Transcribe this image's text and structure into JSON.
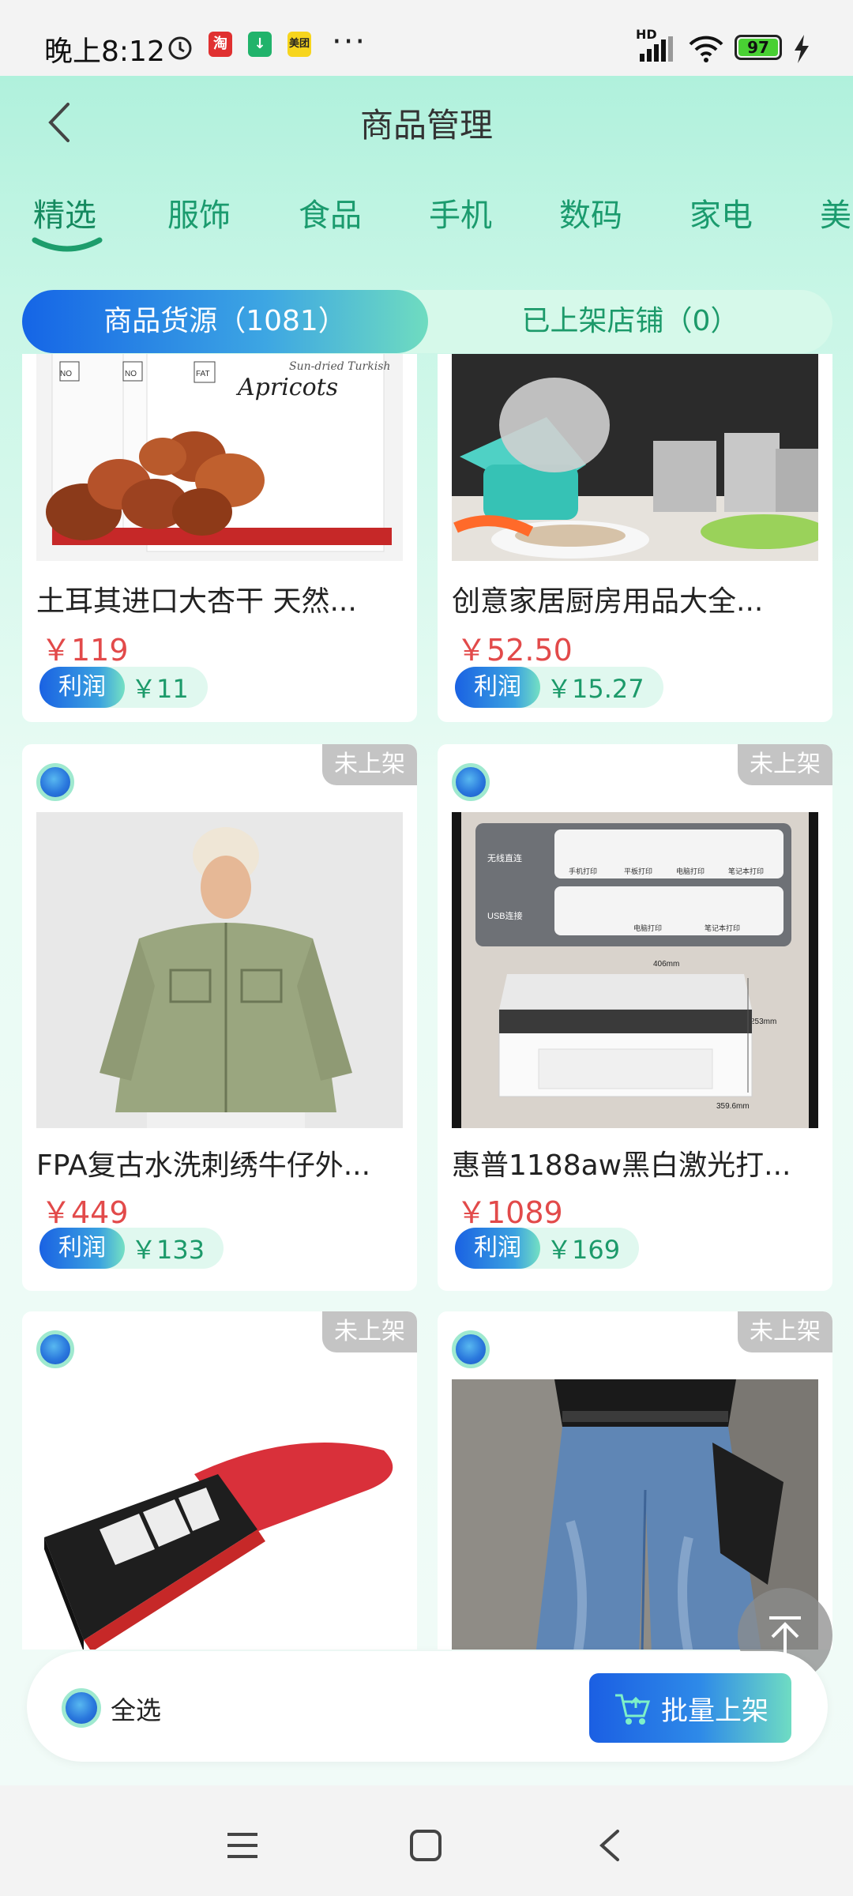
{
  "status_bar": {
    "time": "晚上8:12",
    "apps": [
      {
        "icon": "alarm-icon"
      },
      {
        "icon": "taobao-icon",
        "text": "淘",
        "color": "#e03030"
      },
      {
        "icon": "download-icon",
        "text": "↓",
        "color": "#21b36b"
      },
      {
        "icon": "meituan-icon",
        "text": "美团",
        "color": "#f7d51d"
      }
    ],
    "more": "···",
    "network": "HD",
    "battery": "97"
  },
  "header": {
    "title": "商品管理"
  },
  "categories": [
    {
      "label": "精选",
      "active": true
    },
    {
      "label": "服饰"
    },
    {
      "label": "食品"
    },
    {
      "label": "手机"
    },
    {
      "label": "数码"
    },
    {
      "label": "家电"
    },
    {
      "label": "美"
    }
  ],
  "segments": [
    {
      "label": "商品货源（1081）",
      "active": true
    },
    {
      "label": "已上架店铺（0）"
    }
  ],
  "products": [
    {
      "title": "土耳其进口大杏干 天然...",
      "price": "￥119",
      "profit_label": "利润",
      "profit": "￥11",
      "image": "dried-apricots-image"
    },
    {
      "title": "创意家居厨房用品大全...",
      "price": "￥52.50",
      "profit_label": "利润",
      "profit": "￥15.27",
      "image": "vegetable-grater-image"
    },
    {
      "status": "未上架",
      "title": "FPA复古水洗刺绣牛仔外...",
      "price": "￥449",
      "profit_label": "利润",
      "profit": "￥133",
      "image": "denim-jacket-image"
    },
    {
      "status": "未上架",
      "title": "惠普1188aw黑白激光打...",
      "price": "￥1089",
      "profit_label": "利润",
      "profit": "￥169",
      "image": "laser-printer-image",
      "image_text": {
        "wifi": "无线直连",
        "usb": "USB连接",
        "p1": "手机打印",
        "p2": "平板打印",
        "p3": "电脑打印",
        "p4": "笔记本打印",
        "p5": "电脑打印",
        "p6": "笔记本打印",
        "w": "406mm",
        "h": "253mm",
        "d": "359.6mm"
      }
    },
    {
      "status": "未上架",
      "image": "knife-sharpener-image"
    },
    {
      "status": "未上架",
      "image": "jeans-image"
    }
  ],
  "apricot_pack": {
    "brand": "Apricots",
    "sub": "Sun-dried Turkish",
    "tags": [
      "NO",
      "NO",
      "FAT"
    ]
  },
  "bottom_bar": {
    "select_all": "全选",
    "batch_button": "批量上架"
  }
}
